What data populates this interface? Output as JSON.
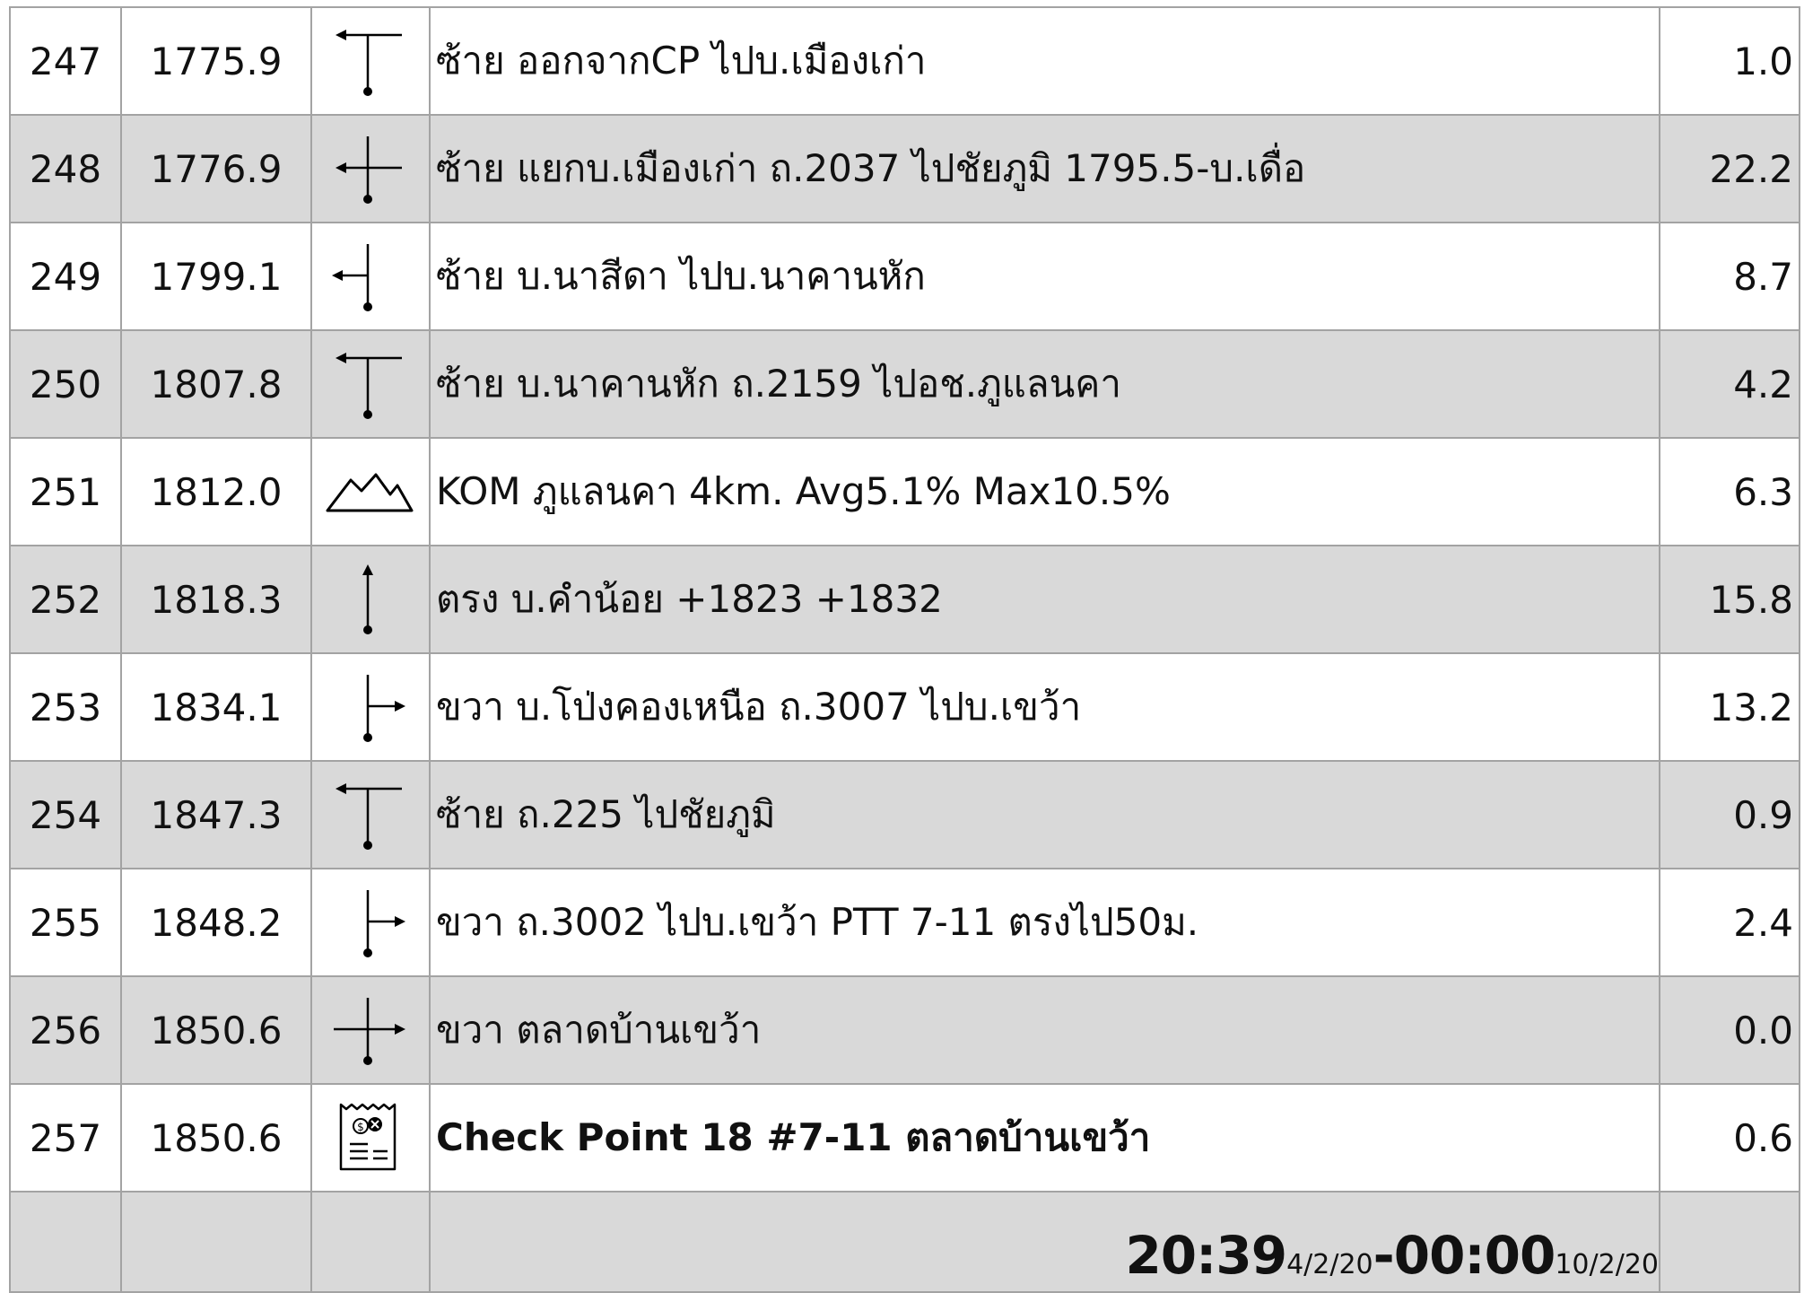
{
  "rows": [
    {
      "no": "247",
      "km": "1775.9",
      "icon": "turn-left-t-icon",
      "desc": "ซ้าย ออกจากCP ไปบ.เมืองเก่า",
      "dist": "1.0",
      "shade": false
    },
    {
      "no": "248",
      "km": "1776.9",
      "icon": "turn-left-cross-icon",
      "desc": "ซ้าย แยกบ.เมืองเก่า ถ.2037 ไปชัยภูมิ 1795.5-บ.เดื่อ",
      "dist": "22.2",
      "shade": true
    },
    {
      "no": "249",
      "km": "1799.1",
      "icon": "turn-left-side-icon",
      "desc": "ซ้าย บ.นาสีดา ไปบ.นาคานหัก",
      "dist": "8.7",
      "shade": false
    },
    {
      "no": "250",
      "km": "1807.8",
      "icon": "turn-left-t-icon",
      "desc": "ซ้าย บ.นาคานหัก ถ.2159 ไปอช.ภูแลนคา",
      "dist": "4.2",
      "shade": true
    },
    {
      "no": "251",
      "km": "1812.0",
      "icon": "mountain-icon",
      "desc": "KOM ภูแลนคา 4km. Avg5.1% Max10.5%",
      "dist": "6.3",
      "shade": false
    },
    {
      "no": "252",
      "km": "1818.3",
      "icon": "straight-arrow-icon",
      "desc": "ตรง บ.คำน้อย +1823 +1832",
      "dist": "15.8",
      "shade": true
    },
    {
      "no": "253",
      "km": "1834.1",
      "icon": "turn-right-side-icon",
      "desc": "ขวา บ.โป่งคองเหนือ ถ.3007 ไปบ.เขว้า",
      "dist": "13.2",
      "shade": false
    },
    {
      "no": "254",
      "km": "1847.3",
      "icon": "turn-left-t-icon",
      "desc": "ซ้าย ถ.225 ไปชัยภูมิ",
      "dist": "0.9",
      "shade": true
    },
    {
      "no": "255",
      "km": "1848.2",
      "icon": "turn-right-side-icon",
      "desc": "ขวา ถ.3002 ไปบ.เขว้า PTT 7-11 ตรงไป50ม.",
      "dist": "2.4",
      "shade": false
    },
    {
      "no": "256",
      "km": "1850.6",
      "icon": "turn-right-cross-icon",
      "desc": "ขวา ตลาดบ้านเขว้า",
      "dist": "0.0",
      "shade": true
    },
    {
      "no": "257",
      "km": "1850.6",
      "icon": "receipt-icon",
      "desc": "Check Point 18 #7-11 ตลาดบ้านเขว้า",
      "dist": "0.6",
      "shade": false
    }
  ],
  "footer": {
    "open_time": "20:39",
    "open_date": "4/2/20",
    "separator": "-",
    "close_time": "00:00",
    "close_date": "10/2/20"
  },
  "colors": {
    "shade": "#d9d9d9",
    "border": "#a3a3a3",
    "kom_text": "#c00000"
  }
}
